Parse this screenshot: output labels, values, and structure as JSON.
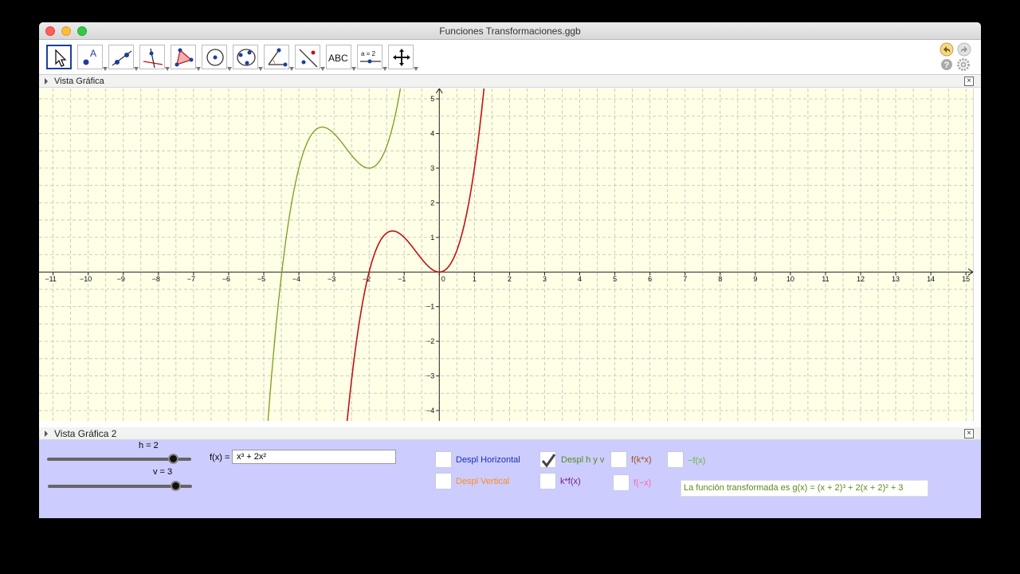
{
  "window": {
    "title": "Funciones Transformaciones.ggb"
  },
  "colors": {
    "graph_bg": "#ffffe6",
    "grid": "#bdbdbd",
    "axis": "#222222",
    "curve_f": "#7b9a1e",
    "curve_g": "#c01212",
    "panel2_bg": "#ccccff",
    "accent_blue": "#1d3f9a"
  },
  "toolbar": {
    "tools": [
      {
        "name": "move-tool",
        "icon": "pointer-icon",
        "active": true
      },
      {
        "name": "point-tool",
        "icon": "point-icon"
      },
      {
        "name": "line-tool",
        "icon": "line-icon"
      },
      {
        "name": "perpendicular-tool",
        "icon": "perpendicular-icon"
      },
      {
        "name": "polygon-tool",
        "icon": "polygon-icon"
      },
      {
        "name": "circle-tool",
        "icon": "circle-icon"
      },
      {
        "name": "conic-tool",
        "icon": "conic-icon"
      },
      {
        "name": "angle-tool",
        "icon": "angle-icon"
      },
      {
        "name": "reflect-tool",
        "icon": "reflect-icon"
      },
      {
        "name": "text-tool",
        "icon": "text-icon",
        "label": "ABC"
      },
      {
        "name": "slider-tool",
        "icon": "slider-icon",
        "label": "a = 2"
      },
      {
        "name": "move-view-tool",
        "icon": "move-view-icon"
      }
    ],
    "right_icons": [
      "undo-icon",
      "redo-icon",
      "help-icon",
      "settings-icon"
    ]
  },
  "view1": {
    "title": "Vista Gráfica",
    "close": "×"
  },
  "view2": {
    "title": "Vista Gráfica 2",
    "close": "×"
  },
  "axes": {
    "xlim": [
      -11.4,
      15.2
    ],
    "ylim": [
      -4.3,
      5.3
    ],
    "x_ticks": [
      -11,
      -10,
      -9,
      -8,
      -7,
      -6,
      -5,
      -4,
      -3,
      -2,
      -1,
      0,
      1,
      2,
      3,
      4,
      5,
      6,
      7,
      8,
      9,
      10,
      11,
      12,
      13,
      14,
      15
    ],
    "y_ticks": [
      -4,
      -3,
      -2,
      -1,
      1,
      2,
      3,
      4,
      5
    ],
    "origin_label": "0"
  },
  "sliders": {
    "h": {
      "label": "h = 2",
      "value": 2,
      "min": -5,
      "max": 3
    },
    "v": {
      "label": "v = 3",
      "value": 3,
      "min": -5,
      "max": 4
    }
  },
  "function_input": {
    "label": "f(x) =",
    "value": "x³ + 2x²"
  },
  "checkboxes": [
    {
      "label": "Despl Horizontal",
      "checked": false,
      "color": "#1a2fb0"
    },
    {
      "label": "Despl Vertical",
      "checked": false,
      "color": "#ff8c1a"
    },
    {
      "label": "Despl h y v",
      "checked": true,
      "color": "#5a8a1a"
    },
    {
      "label": "k*f(x)",
      "checked": false,
      "color": "#7a1a7a"
    },
    {
      "label": "f(k*x)",
      "checked": false,
      "color": "#a0521a"
    },
    {
      "label": "f(−x)",
      "checked": false,
      "color": "#ff66aa"
    },
    {
      "label": "−f(x)",
      "checked": false,
      "color": "#66bb33"
    }
  ],
  "result_text": "La función transformada es g(x) = (x + 2)³ + 2(x + 2)² + 3"
}
